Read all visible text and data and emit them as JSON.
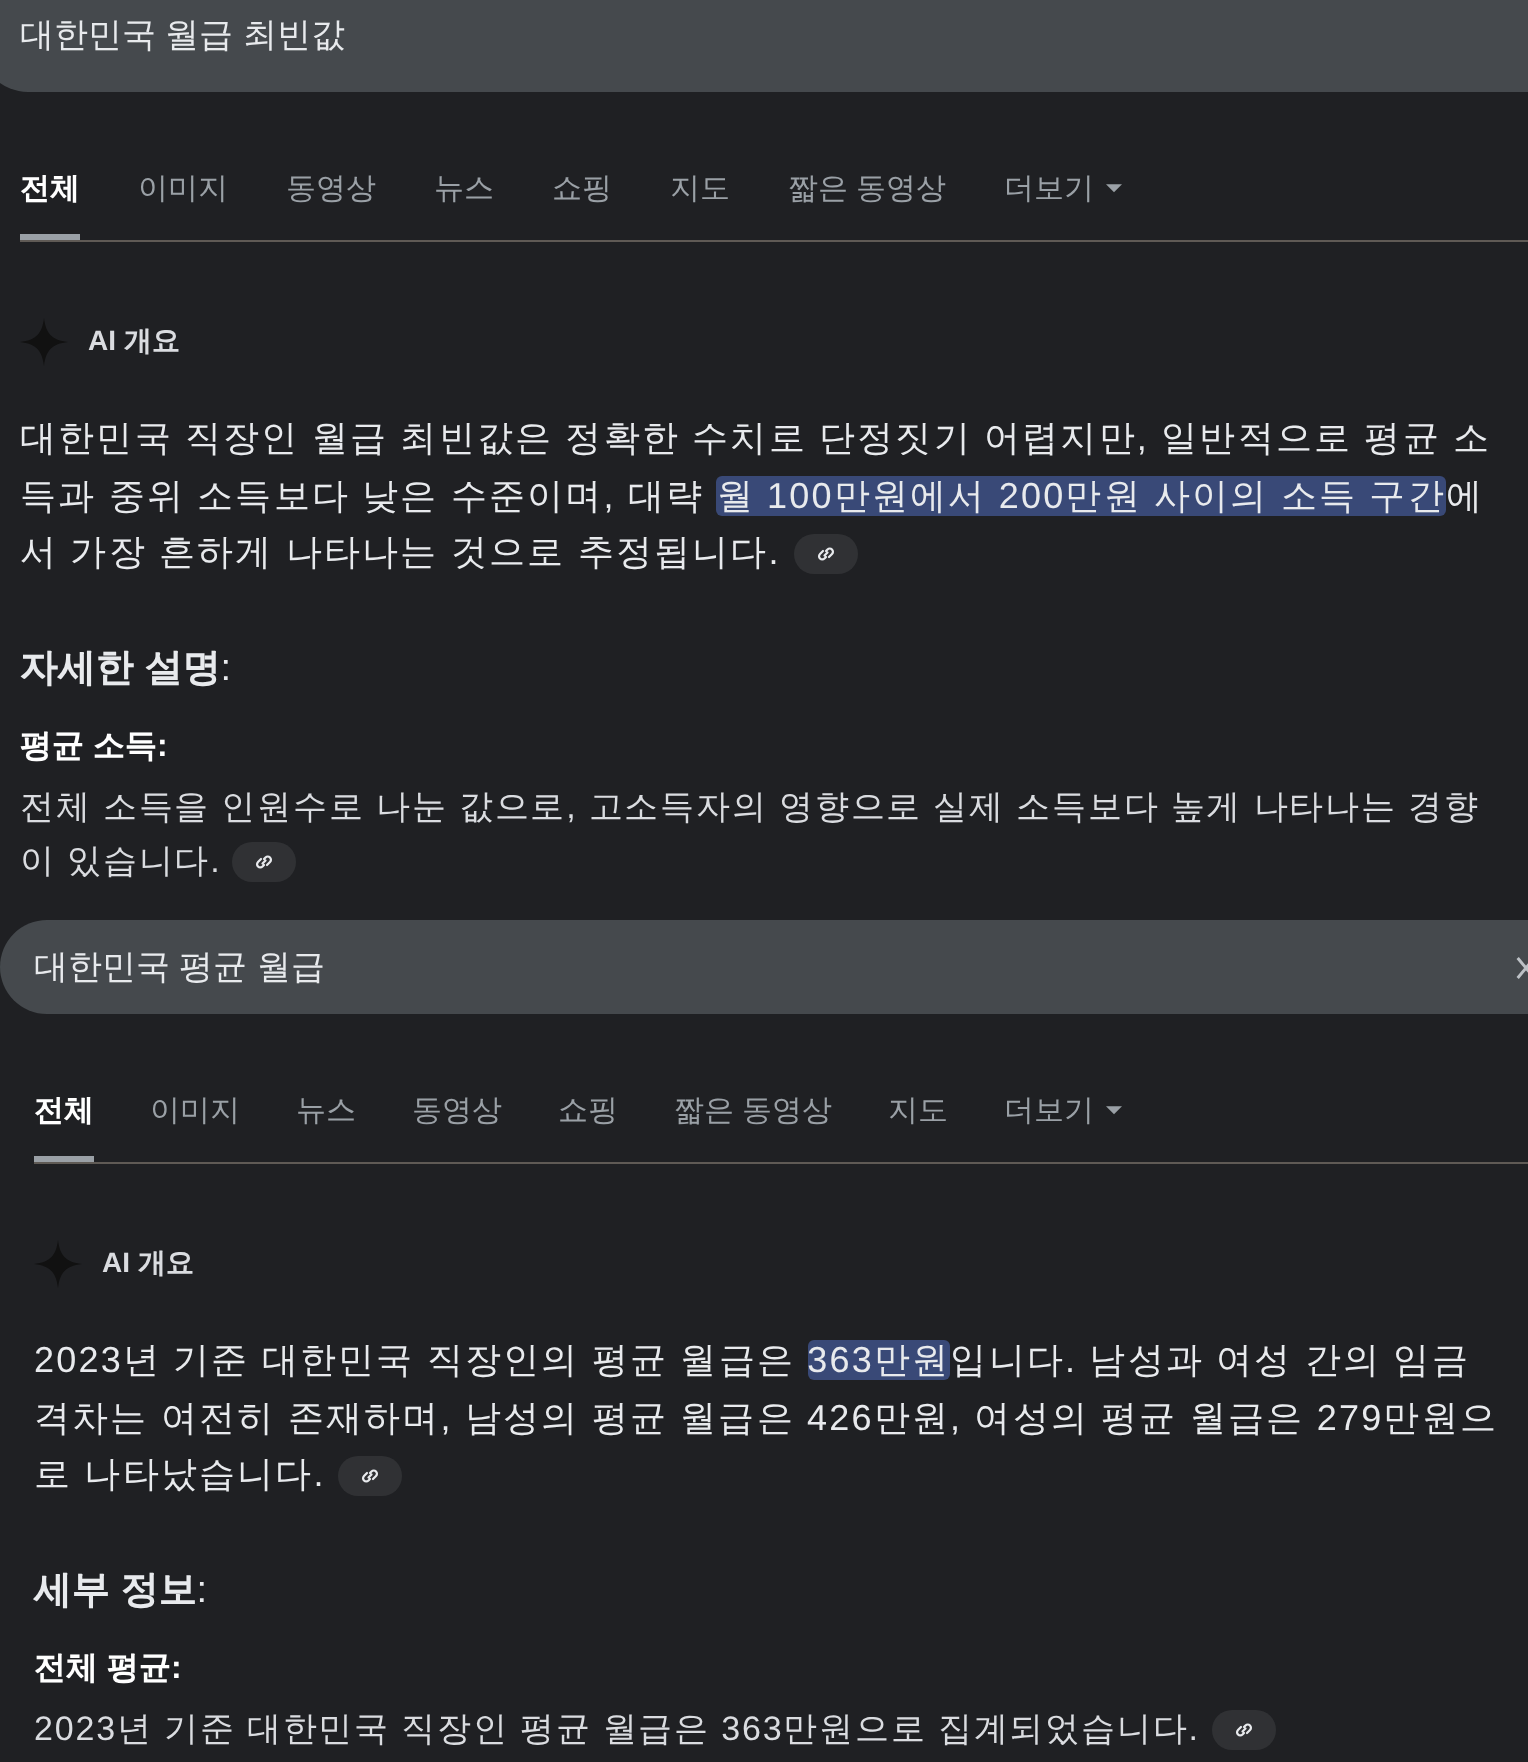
{
  "panels": [
    {
      "search": {
        "value": "대한민국 월급 최빈값",
        "close_visible": false
      },
      "tabs": [
        {
          "label": "전체",
          "selected": true
        },
        {
          "label": "이미지",
          "selected": false
        },
        {
          "label": "동영상",
          "selected": false
        },
        {
          "label": "뉴스",
          "selected": false
        },
        {
          "label": "쇼핑",
          "selected": false
        },
        {
          "label": "지도",
          "selected": false
        },
        {
          "label": "짧은 동영상",
          "selected": false
        },
        {
          "label": "더보기",
          "selected": false,
          "kind": "dropdown"
        }
      ],
      "ai_label": "AI 개요",
      "summary": {
        "before": "대한민국 직장인 월급 최빈값은 정확한 수치로 단정짓기 어렵지만, 일반적으로 평균 소득과 중위 소득보다 낮은 수준이며, 대략 ",
        "highlight": "월 100만원에서 200만원 사이의 소득 구간",
        "after": "에서 가장 흔하게 나타나는 것으로 추정됩니다."
      },
      "heading": "**자세한 설명**:",
      "term": "평균 소득:",
      "detail": "전체 소득을 인원수로 나눈 값으로, 고소득자의 영향으로 실제 소득보다 높게 나타나는 경향이 있습니다."
    },
    {
      "search": {
        "value": "대한민국 평균 월급",
        "close_visible": true
      },
      "tabs": [
        {
          "label": "전체",
          "selected": true
        },
        {
          "label": "이미지",
          "selected": false
        },
        {
          "label": "뉴스",
          "selected": false
        },
        {
          "label": "동영상",
          "selected": false
        },
        {
          "label": "쇼핑",
          "selected": false
        },
        {
          "label": "짧은 동영상",
          "selected": false
        },
        {
          "label": "지도",
          "selected": false
        },
        {
          "label": "더보기",
          "selected": false,
          "kind": "dropdown"
        }
      ],
      "ai_label": "AI 개요",
      "summary": {
        "before": "2023년 기준 대한민국 직장인의 평균 월급은 ",
        "highlight": "363만원",
        "after": "입니다. 남성과 여성 간의 임금 격차는 여전히 존재하며, 남성의 평균 월급은 426만원, 여성의 평균 월급은 279만원으로 나타났습니다."
      },
      "heading": "**세부 정보**:",
      "term": "전체 평균:",
      "detail": "2023년 기준 대한민국 직장인 평균 월급은 363만원으로 집계되었습니다."
    }
  ]
}
